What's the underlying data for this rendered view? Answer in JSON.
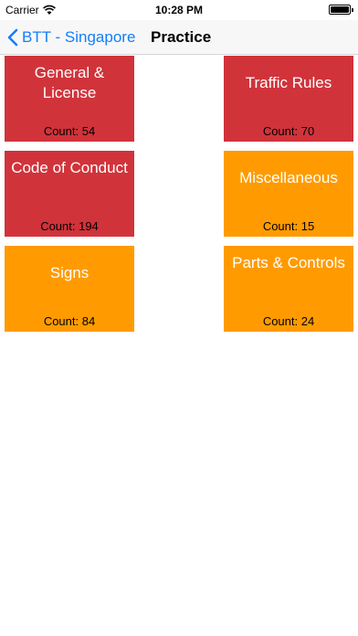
{
  "status_bar": {
    "carrier": "Carrier",
    "time": "10:28 PM"
  },
  "nav": {
    "back_label": "BTT - Singapore",
    "title": "Practice"
  },
  "colors": {
    "accent": "#157efb",
    "tile_red": "#d1333b",
    "tile_orange": "#ff9b00"
  },
  "tiles": [
    {
      "title": "General & License",
      "count": "Count: 54"
    },
    {
      "title": "Traffic Rules",
      "count": "Count: 70"
    },
    {
      "title": "Code of Conduct",
      "count": "Count: 194"
    },
    {
      "title": "Miscellaneous",
      "count": "Count: 15"
    },
    {
      "title": "Signs",
      "count": "Count: 84"
    },
    {
      "title": "Parts & Controls",
      "count": "Count: 24"
    }
  ]
}
